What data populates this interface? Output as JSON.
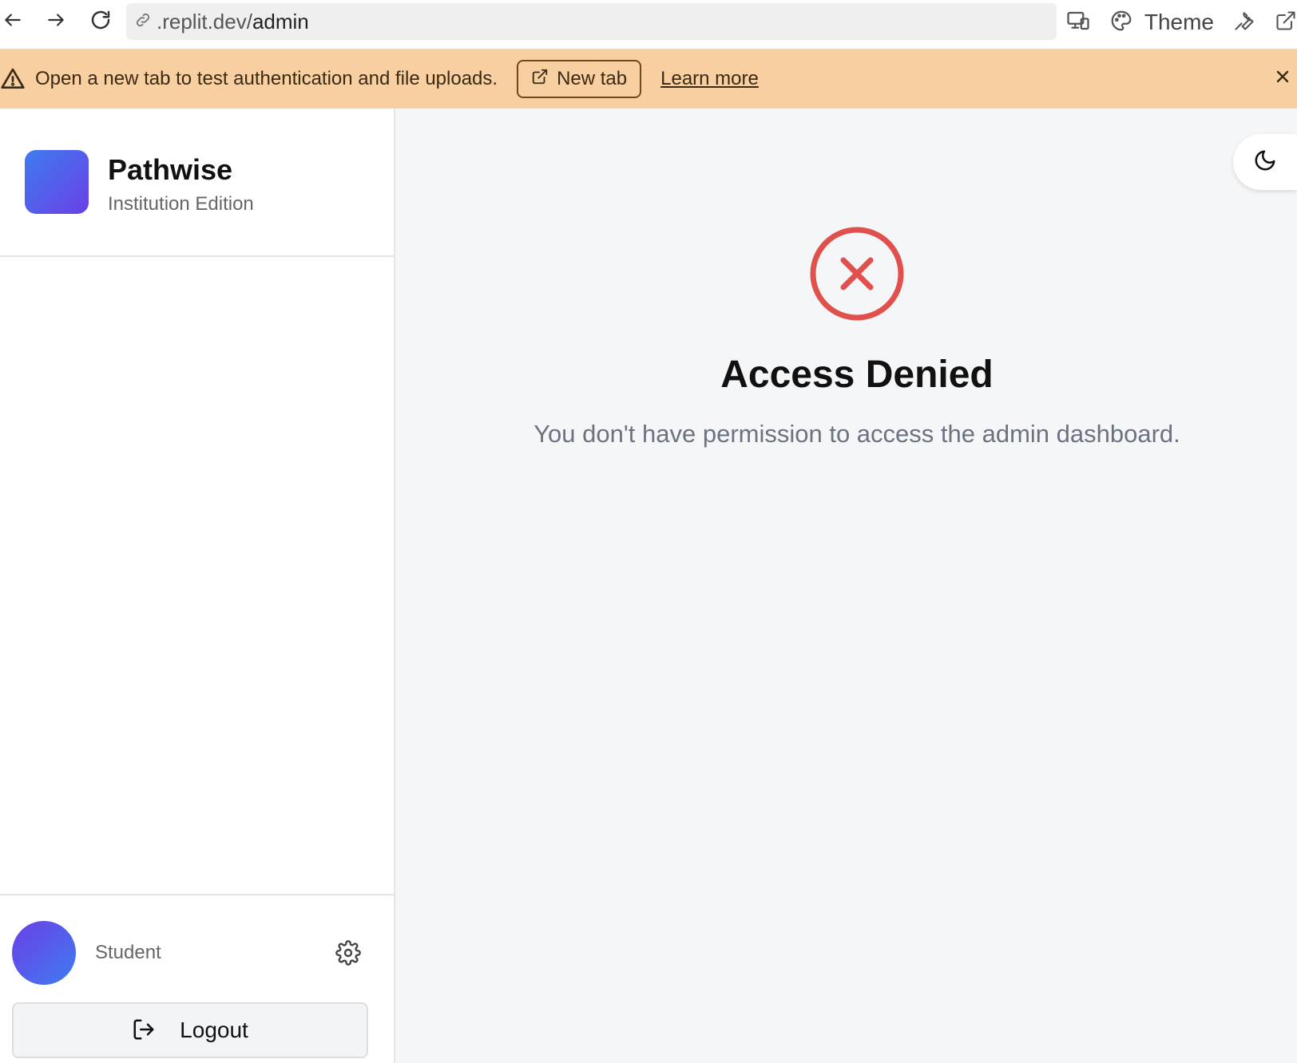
{
  "browser": {
    "url_prefix": ".replit.dev/",
    "url_path": "admin",
    "theme_label": "Theme"
  },
  "banner": {
    "message": "Open a new tab to test authentication and file uploads.",
    "new_tab_label": "New tab",
    "learn_more_label": "Learn more",
    "background": "#f8cfa0"
  },
  "sidebar": {
    "brand_name": "Pathwise",
    "brand_subtitle": "Institution Edition",
    "user_role": "Student",
    "logout_label": "Logout"
  },
  "main": {
    "title": "Access Denied",
    "message": "You don't have permission to access the admin dashboard.",
    "error_color": "#e0504d"
  },
  "icons": [
    "back-arrow-icon",
    "forward-arrow-icon",
    "reload-icon",
    "link-icon",
    "devices-icon",
    "palette-icon",
    "wrench-icon",
    "external-link-icon",
    "warning-icon",
    "close-icon",
    "gear-icon",
    "logout-icon",
    "moon-icon",
    "x-circle-icon"
  ]
}
